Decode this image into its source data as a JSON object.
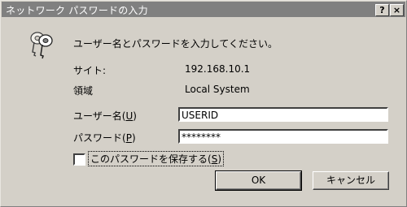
{
  "window": {
    "title": "ネットワーク パスワードの入力",
    "help_btn": "?",
    "close_btn": "×"
  },
  "dialog": {
    "prompt": "ユーザー名とパスワードを入力してください。",
    "site_label": "サイト:",
    "site_value": "192.168.10.1",
    "realm_label": "領域",
    "realm_value": "Local System",
    "username_label": "ユーザー名(",
    "username_key": "U",
    "username_label_end": ")",
    "username_value": "USERID",
    "password_label": "パスワード(",
    "password_key": "P",
    "password_label_end": ")",
    "password_value": "********",
    "save_label": "このパスワードを保存する(",
    "save_key": "S",
    "save_label_end": ")",
    "save_checked": false,
    "ok_button": "OK",
    "cancel_button": "キャンセル"
  },
  "icons": {
    "keys": "key-icon"
  }
}
